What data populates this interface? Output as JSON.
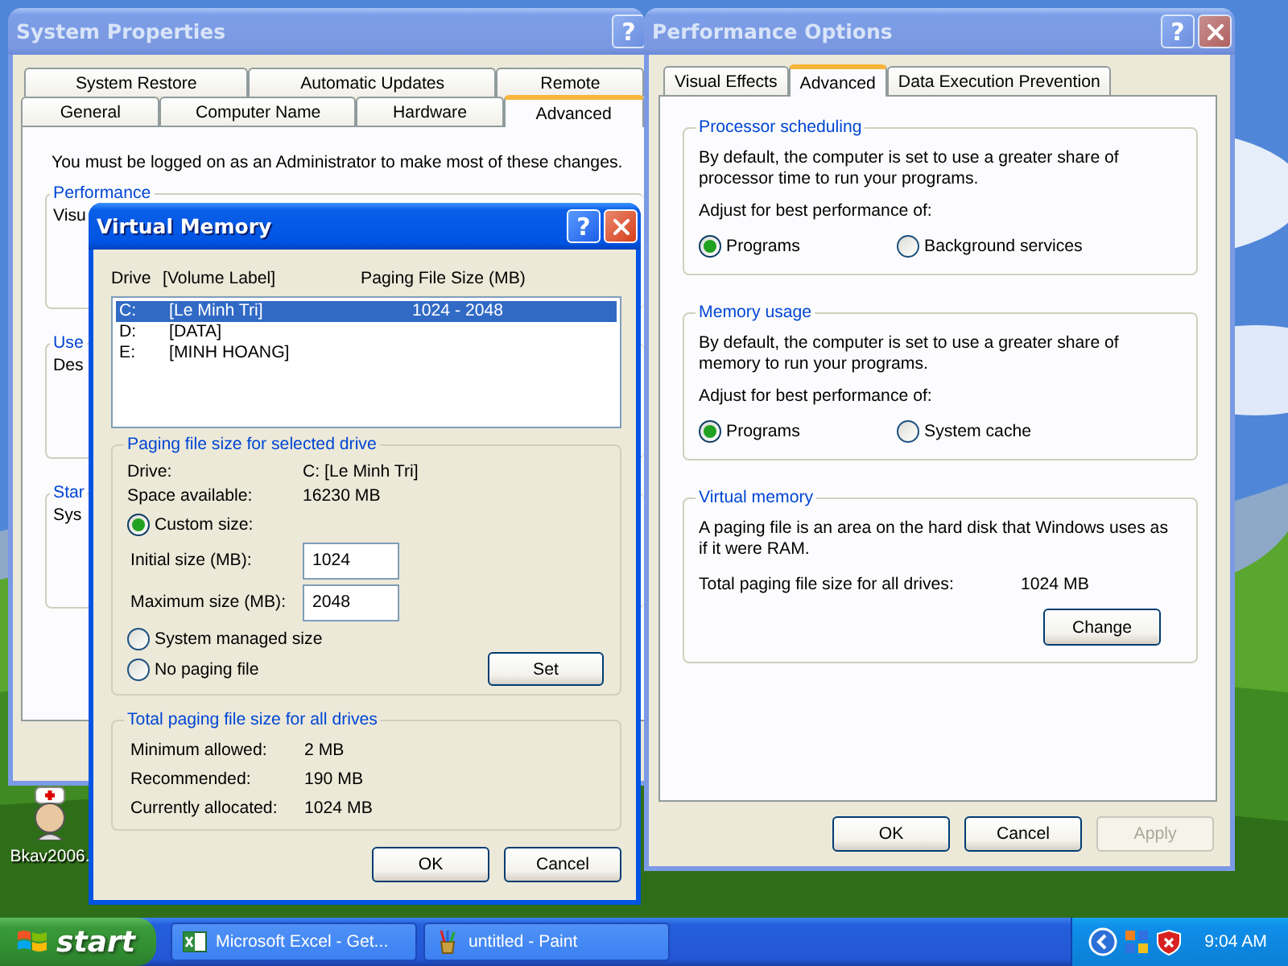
{
  "desktop": {
    "icons": [
      {
        "label": "Bkav2006."
      }
    ]
  },
  "system_properties": {
    "title": "System Properties",
    "active": false,
    "help": "?",
    "tab_rows": [
      [
        {
          "label": "System Restore",
          "selected": false
        },
        {
          "label": "Automatic Updates",
          "selected": false
        },
        {
          "label": "Remote",
          "selected": false
        }
      ],
      [
        {
          "label": "General",
          "selected": false
        },
        {
          "label": "Computer Name",
          "selected": false
        },
        {
          "label": "Hardware",
          "selected": false
        },
        {
          "label": "Advanced",
          "selected": true
        }
      ]
    ],
    "notice": "You must be logged on as an Administrator to make most of these changes.",
    "groups": [
      {
        "title": "Performance",
        "text": "Visu"
      },
      {
        "title": "Use",
        "text": "Des"
      },
      {
        "title": "Star",
        "text": "Sys"
      }
    ]
  },
  "performance_options": {
    "title": "Performance Options",
    "active": false,
    "help": "?",
    "tabs": [
      {
        "label": "Visual Effects",
        "selected": false
      },
      {
        "label": "Advanced",
        "selected": true
      },
      {
        "label": "Data Execution Prevention",
        "selected": false
      }
    ],
    "groups": [
      {
        "kind": "choice",
        "title": "Processor scheduling",
        "text": "By default, the computer is set to use a greater share of processor time to run your programs.",
        "prompt": "Adjust for best performance of:",
        "choices": [
          {
            "label": "Programs",
            "selected": true
          },
          {
            "label": "Background services",
            "selected": false
          }
        ]
      },
      {
        "kind": "choice",
        "title": "Memory usage",
        "text": "By default, the computer is set to use a greater share of memory to run your programs.",
        "prompt": "Adjust for best performance of:",
        "choices": [
          {
            "label": "Programs",
            "selected": true
          },
          {
            "label": "System cache",
            "selected": false
          }
        ]
      },
      {
        "kind": "summary",
        "title": "Virtual memory",
        "text": "A paging file is an area on the hard disk that Windows uses as if it were RAM.",
        "total_label": "Total paging file size for all drives:",
        "total_value": "1024 MB",
        "button": "Change"
      }
    ],
    "buttons": [
      {
        "label": "OK",
        "disabled": false
      },
      {
        "label": "Cancel",
        "disabled": false
      },
      {
        "label": "Apply",
        "disabled": true
      }
    ]
  },
  "virtual_memory": {
    "title": "Virtual Memory",
    "active": true,
    "help": "?",
    "columns": [
      "Drive",
      "[Volume Label]",
      "Paging File Size (MB)"
    ],
    "drives": [
      {
        "drive": "C:",
        "label": "[Le Minh Tri]",
        "size": "1024 - 2048",
        "selected": true
      },
      {
        "drive": "D:",
        "label": "[DATA]",
        "selected": false
      },
      {
        "drive": "E:",
        "label": "[MINH HOANG]",
        "selected": false
      }
    ],
    "selected_drive": {
      "title": "Paging file size for selected drive",
      "info": [
        {
          "label": "Drive:",
          "value": "C:  [Le Minh Tri]"
        },
        {
          "label": "Space available:",
          "value": "16230 MB"
        }
      ],
      "options": [
        {
          "kind": "radio",
          "label": "Custom size:",
          "selected": true
        },
        {
          "kind": "field",
          "label": "Initial size (MB):",
          "value": "1024"
        },
        {
          "kind": "field",
          "label": "Maximum size (MB):",
          "value": "2048"
        },
        {
          "kind": "radio",
          "label": "System managed size",
          "selected": false
        },
        {
          "kind": "radio",
          "label": "No paging file",
          "selected": false
        }
      ],
      "set_button": "Set"
    },
    "totals": {
      "title": "Total paging file size for all drives",
      "rows": [
        {
          "label": "Minimum allowed:",
          "value": "2 MB"
        },
        {
          "label": "Recommended:",
          "value": "190 MB"
        },
        {
          "label": "Currently allocated:",
          "value": "1024 MB"
        }
      ]
    },
    "buttons": [
      {
        "label": "OK",
        "disabled": false
      },
      {
        "label": "Cancel",
        "disabled": false
      }
    ]
  },
  "taskbar": {
    "start": "start",
    "tasks": [
      {
        "kind": "spreadsheet",
        "label": "Microsoft Excel - Get..."
      },
      {
        "kind": "paint",
        "label": "untitled - Paint"
      }
    ],
    "clock": "9:04 AM"
  }
}
